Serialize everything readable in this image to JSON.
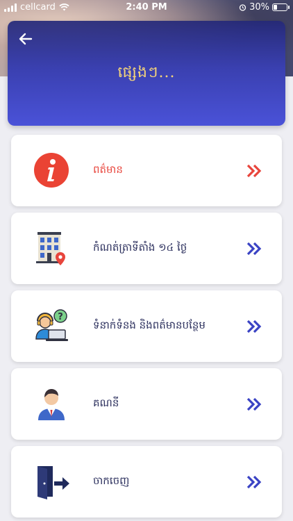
{
  "status_bar": {
    "carrier": "cellcard",
    "time": "2:40 PM",
    "battery_text": "30%",
    "battery_level": 0.3
  },
  "header": {
    "title": "ផ្សេងៗ...",
    "back_icon": "arrow-left-icon"
  },
  "menu": {
    "items": [
      {
        "label": "ពត៌មាន",
        "icon": "info-icon",
        "chevron_color": "#e8453c",
        "label_color": "#e8453c"
      },
      {
        "label": "កំណត់ត្រាទីតាំង ១៤ ថ្ងៃ",
        "icon": "building-location-icon",
        "chevron_color": "#3a43c4",
        "label_color": "#2a2e5c"
      },
      {
        "label": "ទំនាក់ទំនង និងពត៌មានបន្ថែម",
        "icon": "support-agent-icon",
        "chevron_color": "#3a43c4",
        "label_color": "#2a2e5c"
      },
      {
        "label": "គណនី",
        "icon": "user-account-icon",
        "chevron_color": "#3a43c4",
        "label_color": "#2a2e5c"
      },
      {
        "label": "ចាកចេញ",
        "icon": "logout-icon",
        "chevron_color": "#3a43c4",
        "label_color": "#2a2e5c"
      }
    ]
  },
  "colors": {
    "accent_blue": "#3a43c4",
    "accent_red": "#e8453c",
    "title_gold": "#f3d37a"
  }
}
